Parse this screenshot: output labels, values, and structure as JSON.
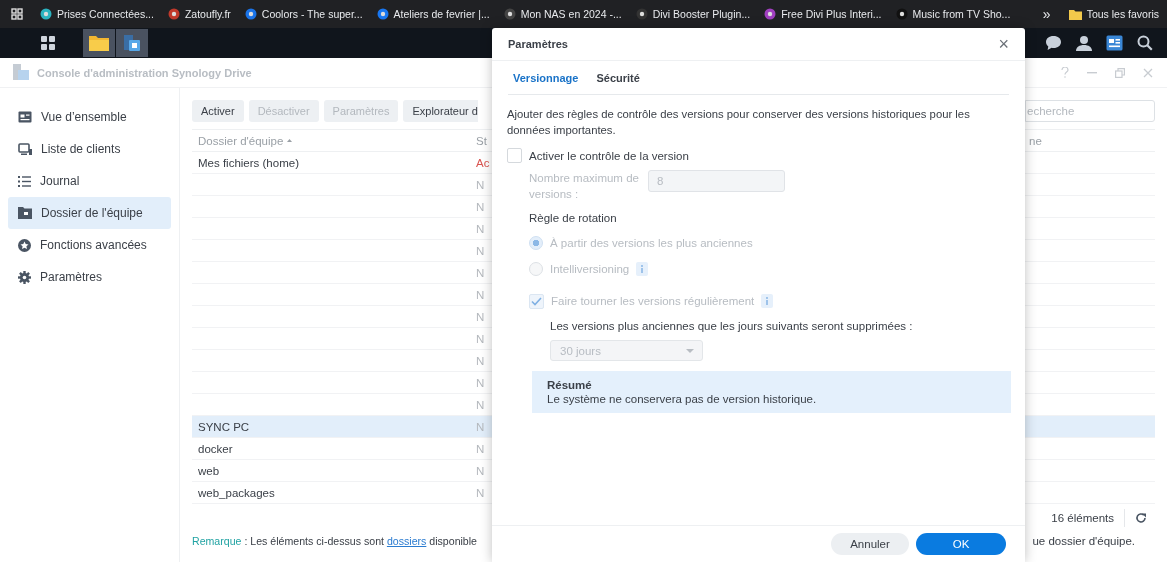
{
  "bookmarks_bar": {
    "items": [
      {
        "label": "Prises Connectées..."
      },
      {
        "label": "Zatoufly.fr"
      },
      {
        "label": "Coolors - The super..."
      },
      {
        "label": "Ateliers de fevrier |..."
      },
      {
        "label": "Mon NAS en 2024 -..."
      },
      {
        "label": "Divi Booster Plugin..."
      },
      {
        "label": "Free Divi Plus Interi..."
      },
      {
        "label": "Music from TV Sho..."
      }
    ],
    "overflow": "»",
    "all_favorites": "Tous les favoris"
  },
  "taskbar": {
    "apps": [
      {
        "open": false
      },
      {
        "open": true
      },
      {
        "open": true
      }
    ]
  },
  "app": {
    "title": "Console d'administration Synology Drive",
    "sidebar": [
      {
        "label": "Vue d’ensemble",
        "selected": false
      },
      {
        "label": "Liste de clients",
        "selected": false
      },
      {
        "label": "Journal",
        "selected": false
      },
      {
        "label": "Dossier de l'équipe",
        "selected": true
      },
      {
        "label": "Fonctions avancées",
        "selected": false
      },
      {
        "label": "Paramètres",
        "selected": false
      }
    ],
    "toolbar": [
      {
        "label": "Activer",
        "disabled": false
      },
      {
        "label": "Désactiver",
        "disabled": true
      },
      {
        "label": "Paramètres",
        "disabled": true
      },
      {
        "label": "Explorateur d",
        "disabled": false
      }
    ],
    "search": {
      "placeholder": "echerche"
    },
    "table": {
      "columns": [
        "Dossier d'équipe",
        "St",
        "ne"
      ],
      "rows": [
        {
          "name": "Mes fichiers (home)",
          "status": "Ac",
          "color": "#d9534f",
          "selected": false
        },
        {
          "status": "N",
          "color": "#b4b8bd",
          "selected": false
        },
        {
          "status": "N",
          "color": "#b4b8bd",
          "selected": false
        },
        {
          "status": "N",
          "color": "#b4b8bd",
          "selected": false
        },
        {
          "status": "N",
          "color": "#b4b8bd",
          "selected": false
        },
        {
          "status": "N",
          "color": "#b4b8bd",
          "selected": false
        },
        {
          "status": "N",
          "color": "#b4b8bd",
          "selected": false
        },
        {
          "status": "N",
          "color": "#b4b8bd",
          "selected": false
        },
        {
          "status": "N",
          "color": "#b4b8bd",
          "selected": false
        },
        {
          "status": "N",
          "color": "#b4b8bd",
          "selected": false
        },
        {
          "status": "N",
          "color": "#b4b8bd",
          "selected": false
        },
        {
          "status": "N",
          "color": "#b4b8bd",
          "selected": false
        },
        {
          "name": "SYNC PC",
          "status": "N",
          "color": "#b4b8bd",
          "selected": true
        },
        {
          "name": "docker",
          "status": "N",
          "color": "#b4b8bd",
          "selected": false
        },
        {
          "name": "web",
          "status": "N",
          "color": "#b4b8bd",
          "selected": false
        },
        {
          "name": "web_packages",
          "status": "N",
          "color": "#b4b8bd",
          "selected": false
        }
      ]
    },
    "count": "16 éléments",
    "remark": {
      "label": "Remarque",
      "text": ": Les éléments ci-dessus sont",
      "link": "dossiers",
      "tail": "disponible"
    },
    "remark_end": "ue dossier d'équipe."
  },
  "dialog": {
    "title": "Paramètres",
    "close": "×",
    "tabs": [
      {
        "label": "Versionnage",
        "selected": true
      },
      {
        "label": "Sécurité",
        "selected": false
      }
    ],
    "description": "Ajouter des règles de contrôle des versions pour conserver des versions historiques pour les données importantes.",
    "enable_versioning": {
      "label": "Activer le contrôle de la version",
      "checked": false
    },
    "max_versions": {
      "label": "Nombre maximum de versions :",
      "value": "8",
      "disabled": true
    },
    "rotation": {
      "title": "Règle de rotation",
      "disabled": true,
      "options": [
        {
          "label": "À partir des versions les plus anciennes",
          "selected": true,
          "info": false
        },
        {
          "label": "Intelliversioning",
          "selected": false,
          "info": true
        }
      ]
    },
    "periodic": {
      "label": "Faire tourner les versions régulièrement",
      "checked": true,
      "disabled": true,
      "info": true
    },
    "retention": {
      "label": "Les versions plus anciennes que les jours suivants seront supprimées :",
      "value": "30 jours",
      "disabled": true
    },
    "summary": {
      "title": "Résumé",
      "text": "Le système ne conservera pas de version historique."
    },
    "buttons": [
      {
        "label": "Annuler",
        "kind": "secondary"
      },
      {
        "label": "OK",
        "kind": "primary"
      }
    ]
  }
}
